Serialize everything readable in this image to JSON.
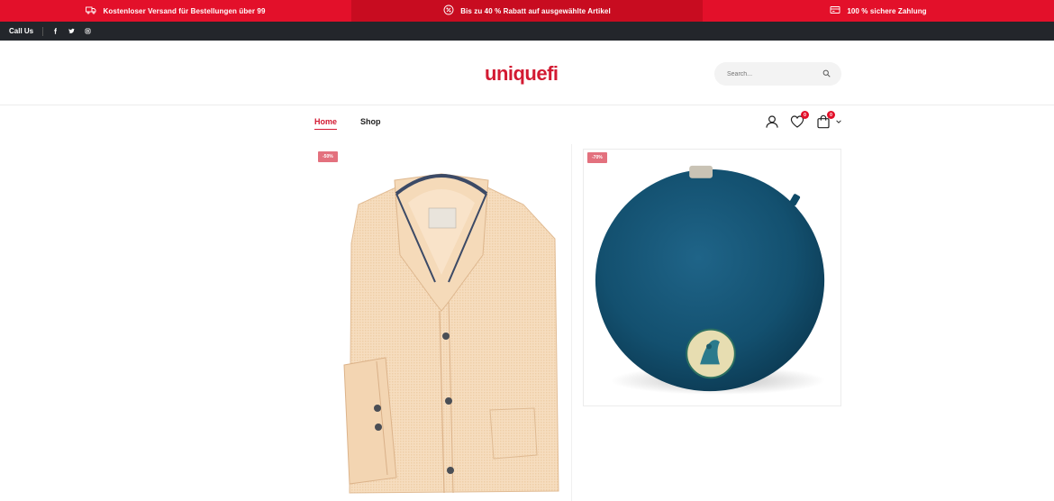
{
  "promo": {
    "items": [
      {
        "icon": "truck-icon",
        "text": "Kostenloser Versand für Bestellungen über 99"
      },
      {
        "icon": "discount-icon",
        "text": "Bis zu 40 % Rabatt auf ausgewählte Artikel"
      },
      {
        "icon": "secure-payment-icon",
        "text": "100 % sichere Zahlung"
      }
    ],
    "colors": {
      "bar": "#e3102a",
      "mid": "#c80c20"
    }
  },
  "topbar": {
    "call_label": "Call Us",
    "social": [
      "facebook-icon",
      "twitter-icon",
      "instagram-icon"
    ]
  },
  "header": {
    "logo": "uniquefi",
    "search_placeholder": "Search..."
  },
  "nav": {
    "links": [
      {
        "label": "Home",
        "active": true
      },
      {
        "label": "Shop",
        "active": false
      }
    ],
    "wishlist_count": "0",
    "cart_count": "0"
  },
  "products": [
    {
      "badge": "-50%",
      "image": "dress-shirt"
    },
    {
      "badge": "-70%",
      "image": "round-teal-cushion-peacock"
    }
  ],
  "colors": {
    "accent": "#d31a32",
    "dark": "#23262b"
  }
}
